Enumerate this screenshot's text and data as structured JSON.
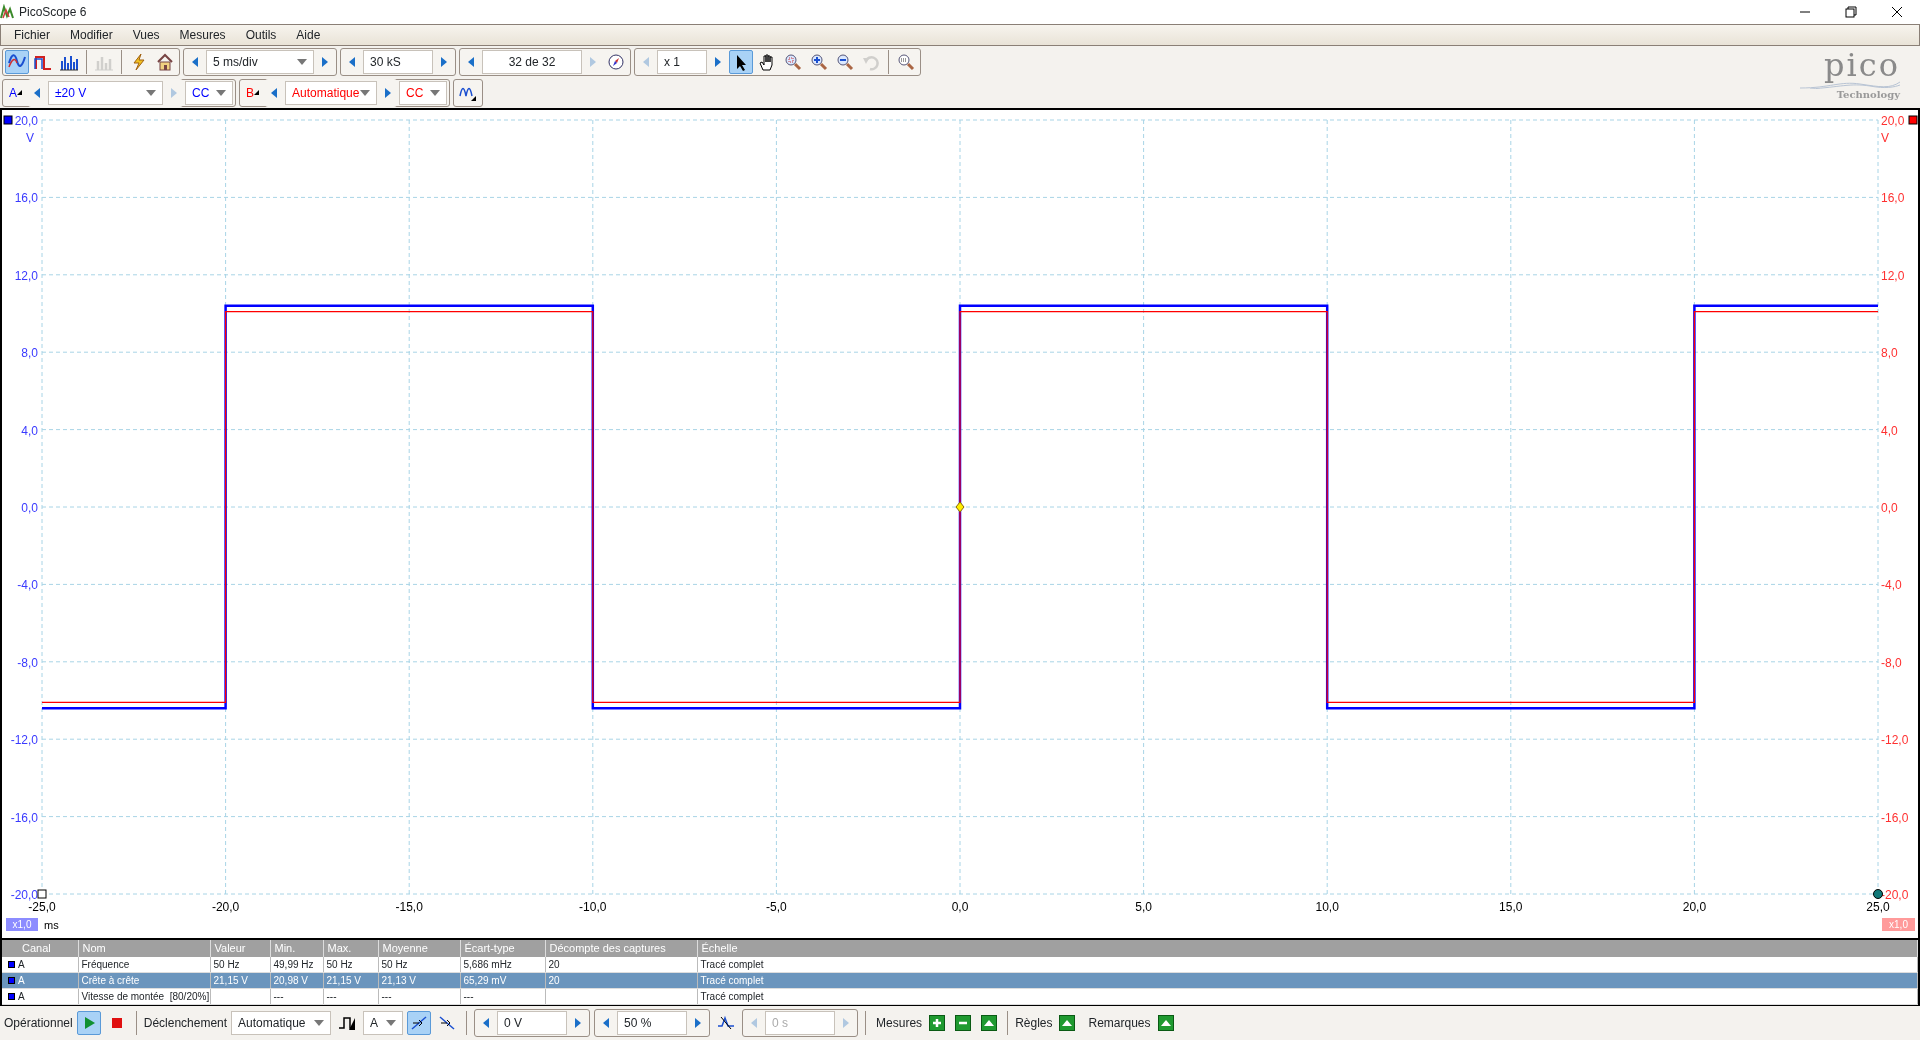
{
  "window": {
    "title": "PicoScope 6"
  },
  "menu": [
    "Fichier",
    "Modifier",
    "Vues",
    "Mesures",
    "Outils",
    "Aide"
  ],
  "view_buttons": [
    {
      "kind": "scope",
      "selected": true,
      "disabled": false
    },
    {
      "kind": "persistence",
      "selected": false,
      "disabled": false
    },
    {
      "kind": "spectrum",
      "selected": false,
      "disabled": false
    },
    {
      "kind": "histogram",
      "selected": false,
      "disabled": true
    }
  ],
  "timebase": "5 ms/div",
  "samples": "30 kS",
  "capture_index": "32 de 32",
  "zoom_factor": "x 1",
  "tools": [
    {
      "kind": "pointer",
      "selected": true,
      "disabled": false
    },
    {
      "kind": "hand",
      "selected": false,
      "disabled": false
    },
    {
      "kind": "zoom-box",
      "selected": false,
      "disabled": false
    },
    {
      "kind": "zoom-in",
      "selected": false,
      "disabled": false
    },
    {
      "kind": "zoom-out",
      "selected": false,
      "disabled": false
    },
    {
      "kind": "undo-zoom",
      "selected": false,
      "disabled": true
    },
    {
      "kind": "zoom-fit",
      "selected": false,
      "disabled": false
    }
  ],
  "channels": [
    {
      "range": "±20 V",
      "coupling": "CC",
      "color": "#0000ff"
    },
    {
      "range": "Automatique",
      "coupling": "CC",
      "color": "#ff0000"
    }
  ],
  "logo": {
    "name": "pico",
    "tagline": "Technology"
  },
  "scope": {
    "chart_data": {
      "type": "line",
      "xlabel": "ms",
      "ylabel": "V",
      "x": [
        -25,
        -20,
        -20,
        -10,
        -10,
        0,
        0,
        10,
        10,
        20,
        20,
        25
      ],
      "series": [
        {
          "name": "A",
          "color": "#0000ff",
          "values": [
            -10.4,
            -10.4,
            10.4,
            10.4,
            -10.4,
            -10.4,
            10.4,
            10.4,
            -10.4,
            -10.4,
            10.4,
            10.4
          ]
        },
        {
          "name": "B",
          "color": "#ff0000",
          "values": [
            -10.1,
            -10.1,
            10.1,
            10.1,
            -10.1,
            -10.1,
            10.1,
            10.1,
            -10.1,
            -10.1,
            10.1,
            10.1
          ]
        }
      ],
      "grid": true,
      "xlim": [
        -25,
        25
      ],
      "ylim": [
        -20,
        20
      ],
      "xticks": [
        {
          "value": -25,
          "label": "-25,0"
        },
        {
          "value": -20,
          "label": "-20,0"
        },
        {
          "value": -15,
          "label": "-15,0"
        },
        {
          "value": -10,
          "label": "-10,0"
        },
        {
          "value": -5,
          "label": "-5,0"
        },
        {
          "value": 0,
          "label": "0,0"
        },
        {
          "value": 5,
          "label": "5,0"
        },
        {
          "value": 10,
          "label": "10,0"
        },
        {
          "value": 15,
          "label": "15,0"
        },
        {
          "value": 20,
          "label": "20,0"
        },
        {
          "value": 25,
          "label": "25,0"
        }
      ],
      "yticks": [
        {
          "value": 20,
          "label": "20,0"
        },
        {
          "value": 16,
          "label": "16,0"
        },
        {
          "value": 12,
          "label": "12,0"
        },
        {
          "value": 8,
          "label": "8,0"
        },
        {
          "value": 4,
          "label": "4,0"
        },
        {
          "value": 0,
          "label": "0,0"
        },
        {
          "value": -4,
          "label": "-4,0"
        },
        {
          "value": -8,
          "label": "-8,0"
        },
        {
          "value": -12,
          "label": "-12,0"
        },
        {
          "value": -16,
          "label": "-16,0"
        },
        {
          "value": -20,
          "label": "-20,0"
        }
      ]
    },
    "right_axis": {
      "unit": "V",
      "ticks": [
        "20,0",
        "16,0",
        "12,0",
        "8,0",
        "4,0",
        "0,0",
        "-4,0",
        "-8,0",
        "-12,0",
        "-16,0",
        "-20,0"
      ]
    },
    "left_scale": "x1,0",
    "right_scale": "x1,0"
  },
  "measurements": {
    "columns": [
      "Canal",
      "Nom",
      "Valeur",
      "Min.",
      "Max.",
      "Moyenne",
      "Écart-type",
      "Décompte des captures",
      "Échelle"
    ],
    "rows": [
      {
        "channel": "A",
        "name": "Fréquence",
        "value": "50 Hz",
        "min": "49,99 Hz",
        "max": "50 Hz",
        "mean": "50 Hz",
        "std_dev": "5,686 mHz",
        "capture_count": "20",
        "scale": "Tracé complet",
        "selected": false
      },
      {
        "channel": "A",
        "name": "Crête à crête",
        "value": "21,15 V",
        "min": "20,98 V",
        "max": "21,15 V",
        "mean": "21,13 V",
        "std_dev": "65,29 mV",
        "capture_count": "20",
        "scale": "Tracé complet",
        "selected": true
      },
      {
        "channel": "A",
        "name": "Vitesse de montée  [80/20%]",
        "min": "---",
        "max": "---",
        "mean": "---",
        "std_dev": "---",
        "scale": "Tracé complet",
        "selected": false
      }
    ]
  },
  "status_bar": {
    "state_label": "Opérationnel",
    "running": true,
    "trigger_label": "Déclenchement",
    "trigger_mode": "Automatique",
    "trigger_source": "A",
    "edges": [
      {
        "kind": "rising",
        "selected": true
      },
      {
        "kind": "falling",
        "selected": false
      }
    ],
    "threshold": "0 V",
    "pretrigger": "50 %",
    "delay": {
      "value": "0 s",
      "disabled": true
    },
    "measures_label": "Mesures",
    "rulers_label": "Règles",
    "notes_label": "Remarques"
  }
}
